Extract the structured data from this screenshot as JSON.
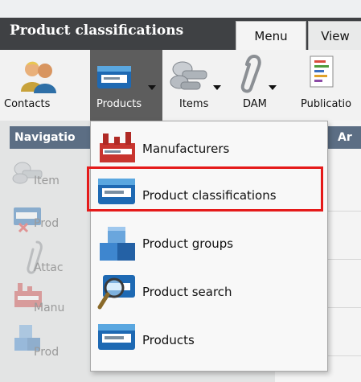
{
  "window": {
    "title": "Product classifications"
  },
  "tabs": [
    {
      "label": "Menu"
    },
    {
      "label": "View"
    }
  ],
  "ribbon": {
    "contacts": "Contacts",
    "products": "Products",
    "items": "Items",
    "dam": "DAM",
    "publications": "Publicatio"
  },
  "navigation": {
    "title": "Navigatio",
    "items": [
      {
        "label": "Item"
      },
      {
        "label": "Prod"
      },
      {
        "label": "Attac"
      },
      {
        "label": "Manu"
      },
      {
        "label": "Prod"
      }
    ]
  },
  "right_pane": {
    "title": "Ar"
  },
  "products_menu": {
    "items": [
      {
        "label": "Manufacturers",
        "icon": "factory-icon"
      },
      {
        "label": "Product classifications",
        "icon": "classification-box-icon",
        "highlighted": true
      },
      {
        "label": "Product groups",
        "icon": "cubes-icon"
      },
      {
        "label": "Product search",
        "icon": "magnifier-box-icon"
      },
      {
        "label": "Products",
        "icon": "product-box-icon"
      }
    ],
    "highlight_color": "#e51a1a"
  }
}
